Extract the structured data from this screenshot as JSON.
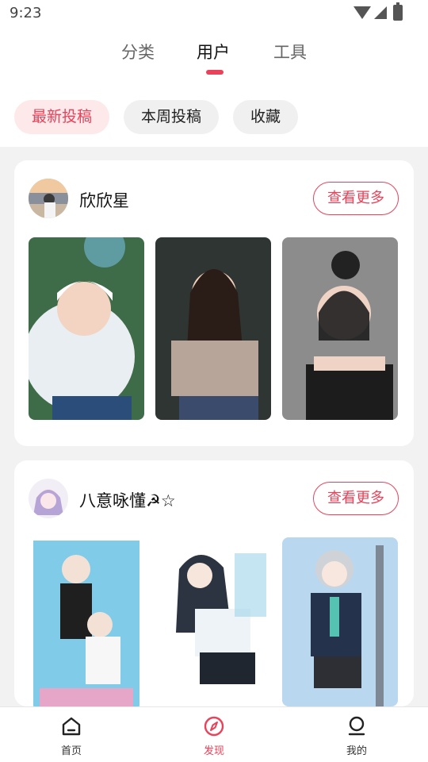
{
  "status_bar": {
    "time": "9:23"
  },
  "top_tabs": [
    {
      "label": "分类",
      "active": false
    },
    {
      "label": "用户",
      "active": true
    },
    {
      "label": "工具",
      "active": false
    }
  ],
  "filters": [
    {
      "label": "最新投稿",
      "active": true
    },
    {
      "label": "本周投稿",
      "active": false
    },
    {
      "label": "收藏",
      "active": false
    }
  ],
  "users": [
    {
      "name": "欣欣星",
      "more_label": "查看更多"
    },
    {
      "name": "八意咏懂☭☆",
      "more_label": "查看更多"
    }
  ],
  "bottom_nav": [
    {
      "label": "首页",
      "icon": "home-icon",
      "active": false
    },
    {
      "label": "发现",
      "icon": "compass-icon",
      "active": true
    },
    {
      "label": "我的",
      "icon": "profile-icon",
      "active": false
    }
  ],
  "colors": {
    "accent": "#e8435a",
    "chip_bg": "#f0f0f0",
    "page_bg": "#f2f2f2"
  }
}
